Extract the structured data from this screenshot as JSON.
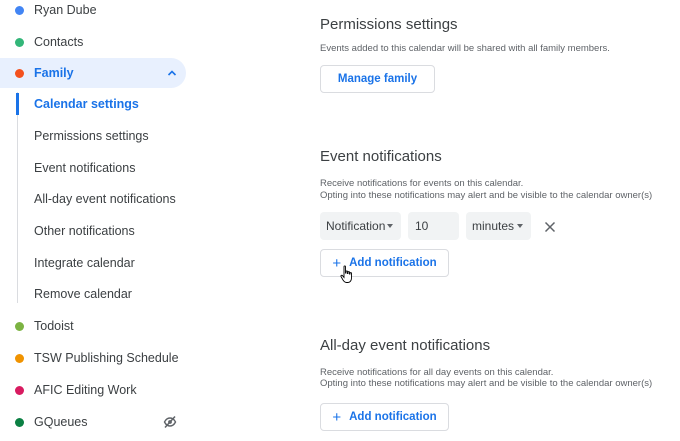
{
  "sidebar": {
    "calendars_top": [
      {
        "label": "Ryan Dube",
        "color": "#4285f4"
      },
      {
        "label": "Contacts",
        "color": "#33b679"
      }
    ],
    "active_calendar": {
      "label": "Family",
      "color": "#f4511e",
      "icon": "chevron-up-icon"
    },
    "sub_items": [
      {
        "label": "Calendar settings",
        "active": true
      },
      {
        "label": "Permissions settings"
      },
      {
        "label": "Event notifications"
      },
      {
        "label": "All-day event notifications"
      },
      {
        "label": "Other notifications"
      },
      {
        "label": "Integrate calendar"
      },
      {
        "label": "Remove calendar"
      }
    ],
    "calendars_bottom": [
      {
        "label": "Todoist",
        "color": "#7cb342"
      },
      {
        "label": "TSW Publishing Schedule",
        "color": "#f09300"
      },
      {
        "label": "AFIC Editing Work",
        "color": "#d81b60"
      },
      {
        "label": "GQueues",
        "color": "#0b8043",
        "icon": "eye-off-icon"
      }
    ]
  },
  "permissions": {
    "title": "Permissions settings",
    "description": "Events added to this calendar will be shared with all family members.",
    "button_label": "Manage family"
  },
  "event_notifications": {
    "title": "Event notifications",
    "description_line1": "Receive notifications for events on this calendar.",
    "description_line2": "Opting into these notifications may alert and be visible to the calendar owner(s)",
    "notification": {
      "type": "Notification",
      "value": "10",
      "unit": "minutes"
    },
    "add_label": "Add notification"
  },
  "allday_notifications": {
    "title": "All-day event notifications",
    "description_line1": "Receive notifications for all day events on this calendar.",
    "description_line2": "Opting into these notifications may alert and be visible to the calendar owner(s)",
    "add_label": "Add notification"
  },
  "colors": {
    "accent": "#1a73e8",
    "active_bg": "#e8f0fe",
    "text": "#3c4043",
    "muted": "#5f6368"
  }
}
